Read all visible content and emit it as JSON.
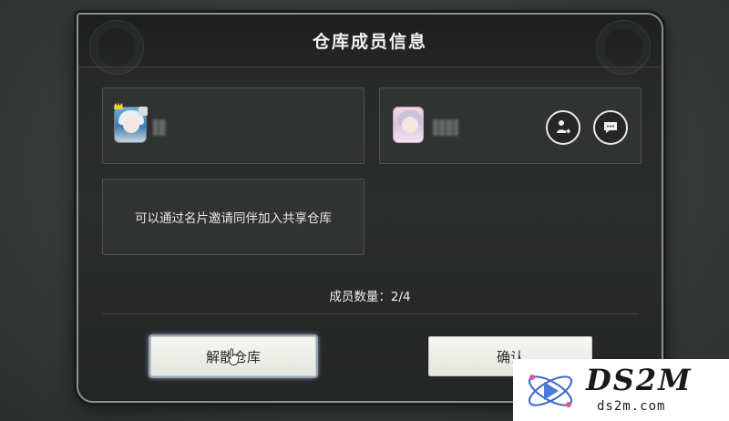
{
  "dialog": {
    "title": "仓库成员信息"
  },
  "members": [
    {
      "role": "owner",
      "avatar_icon": "character-avatar-icon",
      "badge_icon": "crown-icon"
    },
    {
      "role": "member",
      "avatar_icon": "character-avatar-icon",
      "actions": [
        "transfer-icon",
        "chat-icon"
      ]
    }
  ],
  "invite": {
    "text": "可以通过名片邀请同伴加入共享仓库"
  },
  "member_count": {
    "text": "成员数量：2/4"
  },
  "buttons": {
    "dissolve_label": "解散仓库",
    "confirm_label": "确认"
  },
  "watermark": {
    "brand": "DS2M",
    "url": "ds2m.com"
  },
  "colors": {
    "panel": "#262727",
    "border": "#8c9090",
    "button_bg": "#f2f2ee",
    "highlight": "#a6c0d4"
  }
}
